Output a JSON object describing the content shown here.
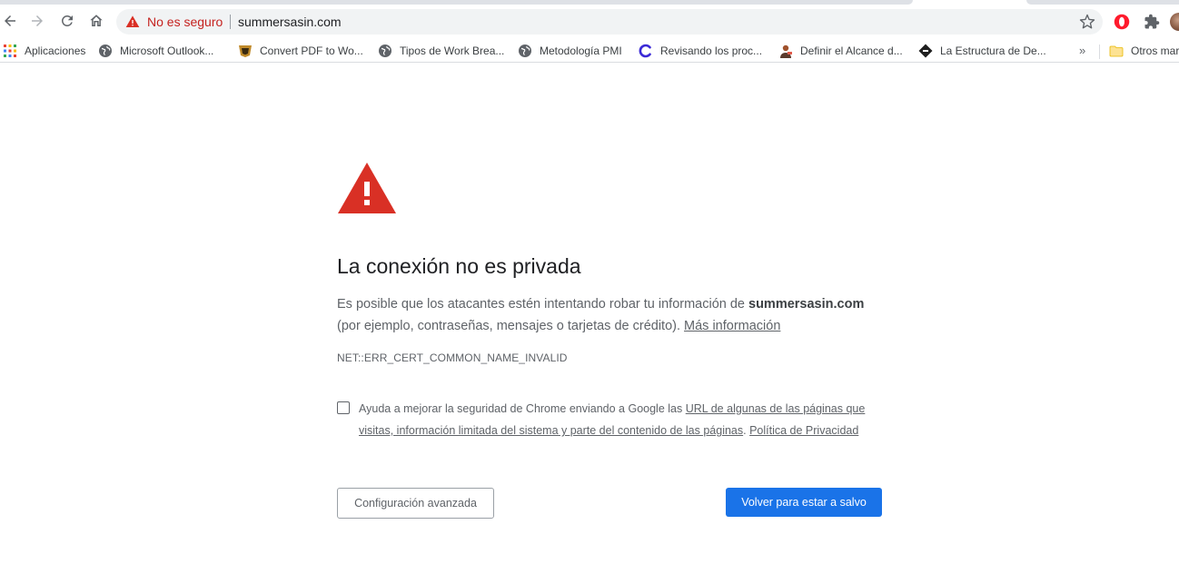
{
  "browser": {
    "omnibox": {
      "security_status": "No es seguro",
      "url": "summersasin.com"
    },
    "icons": {
      "back": "arrow-left-icon",
      "forward": "arrow-right-icon",
      "reload": "reload-icon",
      "home": "home-icon",
      "warning": "warning-triangle-icon",
      "bookmark_star": "star-icon",
      "opera_extension": "opera-icon",
      "extensions": "puzzle-icon"
    },
    "bookmarks": [
      {
        "label": "Aplicaciones",
        "icon": "apps-grid-icon"
      },
      {
        "label": "Microsoft Outlook...",
        "icon": "globe-icon"
      },
      {
        "label": "Convert PDF to Wo...",
        "icon": "pdf-converter-icon"
      },
      {
        "label": "Tipos de Work Brea...",
        "icon": "globe-icon"
      },
      {
        "label": "Metodología PMI",
        "icon": "globe-icon"
      },
      {
        "label": "Revisando los proc...",
        "icon": "c-logo-icon"
      },
      {
        "label": "Definir el Alcance d...",
        "icon": "person-icon"
      },
      {
        "label": "La Estructura de De...",
        "icon": "diamond-icon"
      }
    ],
    "bookmarks_overflow": "»",
    "other_bookmarks": "Otros mar"
  },
  "page": {
    "heading": "La conexión no es privada",
    "desc_prefix": "Es posible que los atacantes estén intentando robar tu información de ",
    "desc_domain": "summersasin.com",
    "desc_suffix": " (por ejemplo, contraseñas, mensajes o tarjetas de crédito). ",
    "more_info_link": "Más información",
    "error_code": "NET::ERR_CERT_COMMON_NAME_INVALID",
    "optin_prefix": "Ayuda a mejorar la seguridad de Chrome enviando a Google las ",
    "optin_link": "URL de algunas de las páginas que visitas, información limitada del sistema y parte del contenido de las páginas",
    "optin_sep": ". ",
    "privacy_link": "Política de Privacidad",
    "advanced_button": "Configuración avanzada",
    "back_to_safety_button": "Volver para estar a salvo"
  },
  "colors": {
    "accent_blue": "#1a73e8",
    "warning_red": "#d93025",
    "omnibox_bg": "#f1f3f4"
  }
}
